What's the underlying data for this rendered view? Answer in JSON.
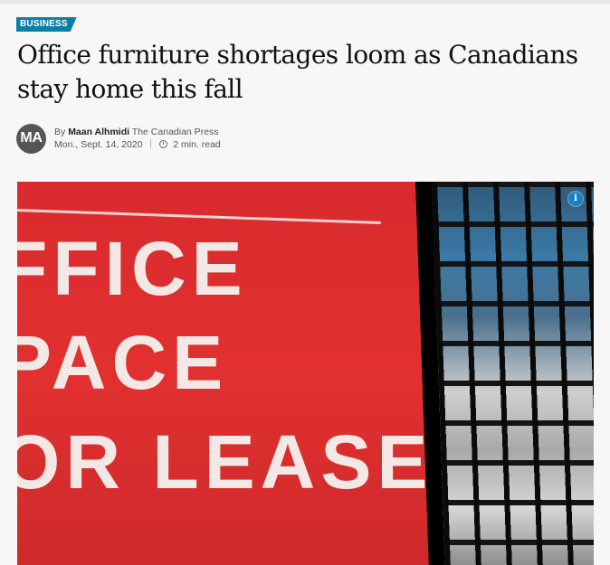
{
  "article": {
    "section_tag": "BUSINESS",
    "headline": "Office furniture shortages loom as Canadians stay home this fall",
    "byline": {
      "by": "By",
      "author": "Maan Alhmidi",
      "organization": "The Canadian Press",
      "avatar_initials": "MA",
      "date": "Mon., Sept. 14, 2020",
      "read_time": "2 min. read"
    },
    "image": {
      "sign_lines": [
        "FFICE",
        "PACE",
        "OR LEASE"
      ],
      "info_icon": "info-icon"
    }
  },
  "colors": {
    "tag_bg": "#0b7fa6",
    "sign_red": "#e1302f",
    "avatar_bg": "#555555",
    "info_icon_bg": "#1a7fc6"
  }
}
